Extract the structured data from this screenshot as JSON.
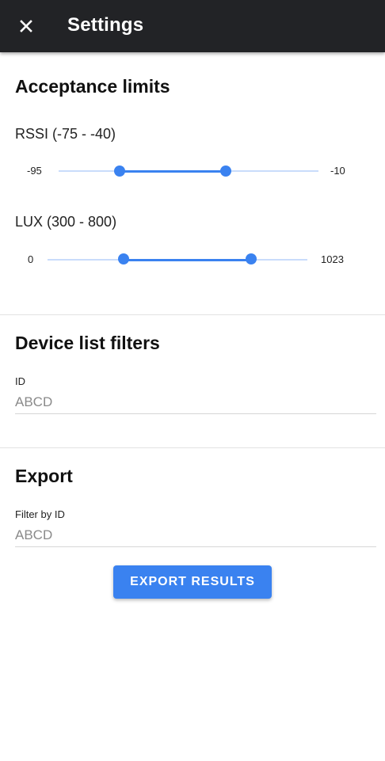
{
  "appbar": {
    "close_icon": "close-icon",
    "title": "Settings"
  },
  "acceptance": {
    "title": "Acceptance limits",
    "rssi": {
      "label": "RSSI (-75 - -40)",
      "min": "-95",
      "max": "-10",
      "low": -75,
      "high": -40
    },
    "lux": {
      "label": "LUX (300 - 800)",
      "min": "0",
      "max": "1023",
      "low": 300,
      "high": 800
    }
  },
  "filters": {
    "title": "Device list filters",
    "id_label": "ID",
    "id_placeholder": "ABCD"
  },
  "export": {
    "title": "Export",
    "filter_label": "Filter by ID",
    "filter_placeholder": "ABCD",
    "button_label": "EXPORT RESULTS"
  },
  "colors": {
    "appbar": "#222326",
    "accent": "#3a82f0",
    "track_inactive": "#c9dcfb"
  }
}
